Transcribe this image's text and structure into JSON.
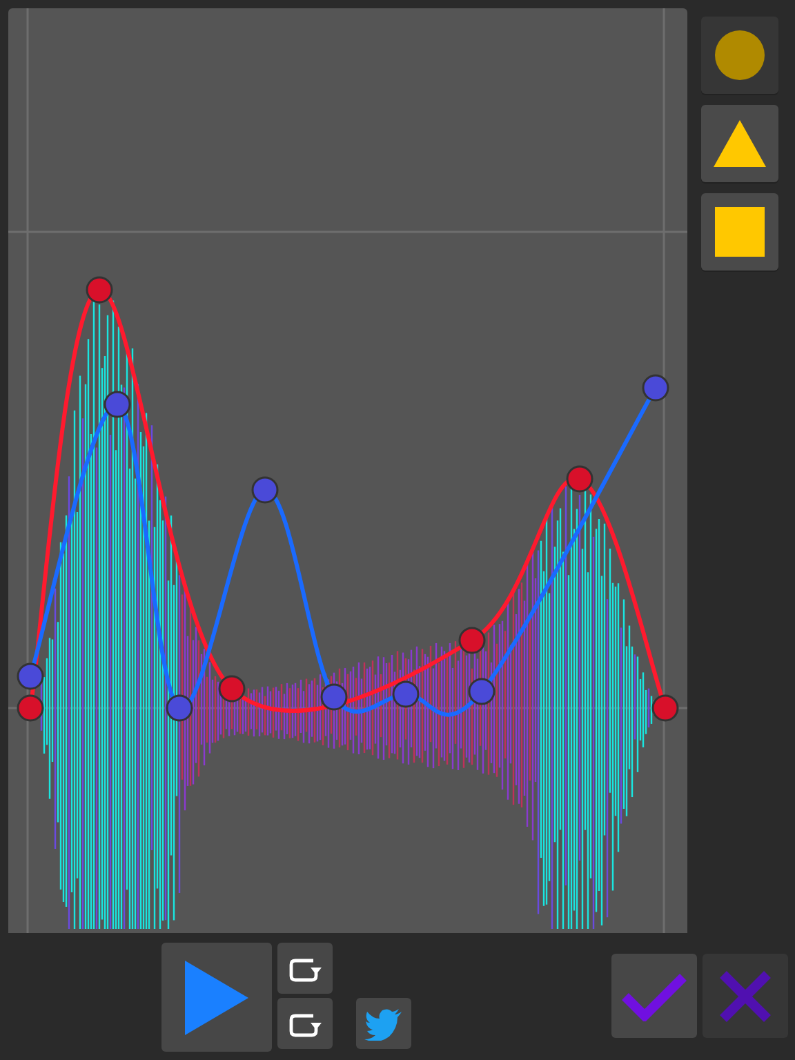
{
  "shape_tools": [
    {
      "kind": "circle",
      "selected": true
    },
    {
      "kind": "triangle",
      "selected": false
    },
    {
      "kind": "square",
      "selected": false
    }
  ],
  "controls": [
    {
      "kind": "play",
      "disabled": false
    },
    {
      "kind": "loop",
      "disabled": false
    },
    {
      "kind": "loop",
      "disabled": false
    },
    {
      "kind": "share",
      "disabled": false
    },
    {
      "kind": "confirm",
      "disabled": false
    },
    {
      "kind": "cancel",
      "disabled": true
    }
  ]
}
